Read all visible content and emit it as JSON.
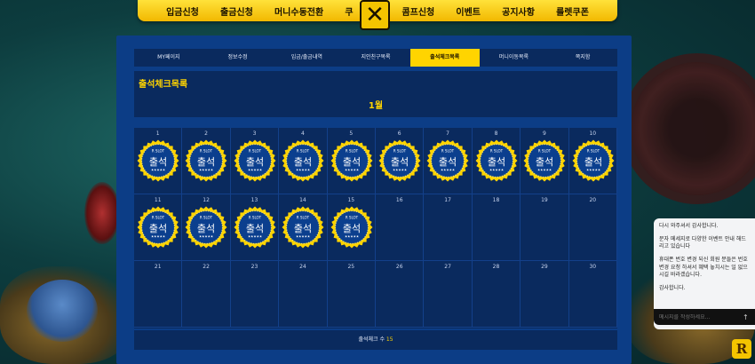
{
  "nav": [
    "입금신청",
    "출금신청",
    "머니수동전환",
    "쿠",
    "콤프신청",
    "이벤트",
    "공지사항",
    "룰렛쿠폰"
  ],
  "tabs": [
    "MY페이지",
    "정보수정",
    "입금/출금내역",
    "지인친구목록",
    "출석체크목록",
    "머니이동목록",
    "쪽지함"
  ],
  "active_tab": 4,
  "page_title": "출석체크목록",
  "month": "1월",
  "stamp": {
    "brand": "R SLOT",
    "label": "출석",
    "stars": "★★★★★"
  },
  "calendar_days": [
    "1",
    "2",
    "3",
    "4",
    "5",
    "6",
    "7",
    "8",
    "9",
    "10",
    "11",
    "12",
    "13",
    "14",
    "15",
    "16",
    "17",
    "18",
    "19",
    "20",
    "21",
    "22",
    "23",
    "24",
    "25",
    "26",
    "27",
    "28",
    "29",
    "30"
  ],
  "attended_days": 15,
  "summary": {
    "label": "출석체크 수",
    "count": "15"
  },
  "chat": {
    "messages": [
      "다시 와주셔서 감사합니다.",
      "문자 메세지로 다양한 이벤트 안내 해드리고 있습니다",
      "휴대폰 번호 변경 되신 회원 분들은 번호 변경 요청 하셔서 혜택 놓치시는 일 없으시길 바라겠습니다.",
      "감사합니다."
    ],
    "placeholder": "메시지를 작성하세요..."
  },
  "colors": {
    "accent": "#ffd400",
    "panel": "#0c3d86",
    "panel_dark": "#0a2a5e"
  }
}
